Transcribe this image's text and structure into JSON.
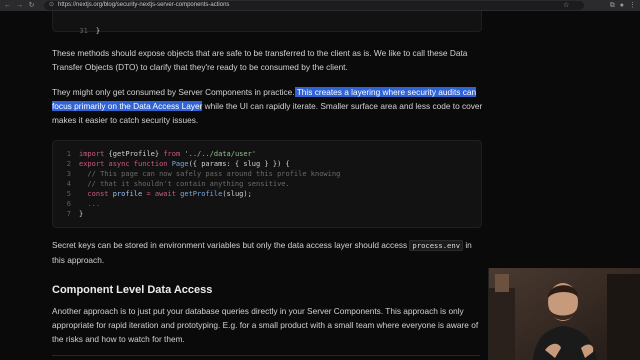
{
  "browser": {
    "url": "https://nextjs.org/blog/security-nextjs-server-components-actions",
    "back_icon": "arrow-left-icon",
    "forward_icon": "arrow-right-icon",
    "reload_icon": "reload-icon"
  },
  "code_top": {
    "line_number": "31",
    "line_text": "}"
  },
  "paragraphs": {
    "p1": "These methods should expose objects that are safe to be transferred to the client as is. We like to call these Data Transfer Objects (DTO) to clarify that they're ready to be consumed by the client.",
    "p2_before": "They might only get consumed by Server Components in practice.",
    "p2_highlight": " This creates a layering where security audits can focus primarily on the Data Access Layer",
    "p2_after": " while the UI can rapidly iterate. Smaller surface area and less code to cover makes it easier to catch security issues.",
    "p3_before": "Secret keys can be stored in environment variables but only the data access layer should access ",
    "p3_code": "process.env",
    "p3_after": " in this approach.",
    "p4": "Another approach is to just put your database queries directly in your Server Components. This approach is only appropriate for rapid iteration and prototyping. E.g. for a small product with a small team where everyone is aware of the risks and how to watch for them."
  },
  "heading": "Component Level Data Access",
  "code_block": {
    "lines": [
      {
        "n": "1",
        "tokens": [
          [
            "kw",
            "import "
          ],
          [
            "pl",
            "{getProfile} "
          ],
          [
            "kw",
            "from "
          ],
          [
            "str",
            "'../../data/user'"
          ]
        ]
      },
      {
        "n": "2",
        "tokens": [
          [
            "kw",
            "export async function "
          ],
          [
            "fn",
            "Page"
          ],
          [
            "pl",
            "({ params: { slug } }) {"
          ]
        ]
      },
      {
        "n": "3",
        "tokens": [
          [
            "cm",
            "  // This page can now safely pass around this profile knowing"
          ]
        ]
      },
      {
        "n": "4",
        "tokens": [
          [
            "cm",
            "  // that it shouldn't contain anything sensitive."
          ]
        ]
      },
      {
        "n": "5",
        "tokens": [
          [
            "kw",
            "  const "
          ],
          [
            "var",
            "profile "
          ],
          [
            "kw",
            "= await "
          ],
          [
            "fn",
            "getProfile"
          ],
          [
            "pl",
            "(slug);"
          ]
        ]
      },
      {
        "n": "6",
        "tokens": [
          [
            "cm",
            "  ..."
          ]
        ]
      },
      {
        "n": "7",
        "tokens": [
          [
            "pl",
            "}"
          ]
        ]
      }
    ]
  }
}
